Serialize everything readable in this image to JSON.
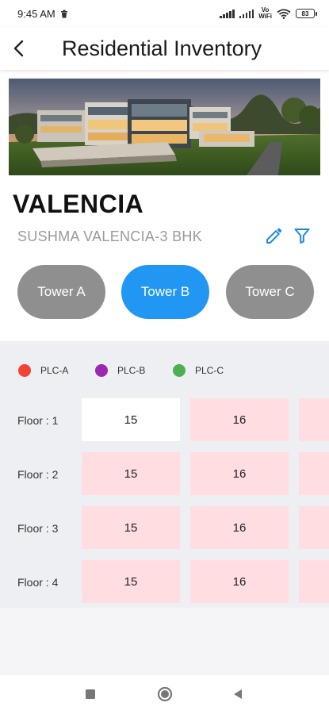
{
  "status_bar": {
    "time": "9:45 AM",
    "volte": "Vo\nWiFi",
    "battery": "83"
  },
  "header": {
    "title": "Residential Inventory",
    "back_icon": "chevron-left-icon"
  },
  "project": {
    "name": "VALENCIA",
    "subtitle": "SUSHMA VALENCIA-3 BHK",
    "edit_icon": "pencil-icon",
    "filter_icon": "filter-icon"
  },
  "towers": [
    {
      "label": "Tower A",
      "active": false
    },
    {
      "label": "Tower B",
      "active": true
    },
    {
      "label": "Tower C",
      "active": false
    }
  ],
  "legend": [
    {
      "label": "PLC-A",
      "color": "#f44336"
    },
    {
      "label": "PLC-B",
      "color": "#9c27b0"
    },
    {
      "label": "PLC-C",
      "color": "#4caf50"
    }
  ],
  "floors": [
    {
      "label": "Floor : 1",
      "units": [
        "15",
        "16"
      ]
    },
    {
      "label": "Floor : 2",
      "units": [
        "15",
        "16"
      ]
    },
    {
      "label": "Floor : 3",
      "units": [
        "15",
        "16"
      ]
    },
    {
      "label": "Floor : 4",
      "units": [
        "15",
        "16"
      ]
    }
  ],
  "colors": {
    "accent": "#2196f3",
    "inactive_tower": "#8f8f8f",
    "unit_available": "#ffffff",
    "unit_booked": "#ffdde0"
  }
}
